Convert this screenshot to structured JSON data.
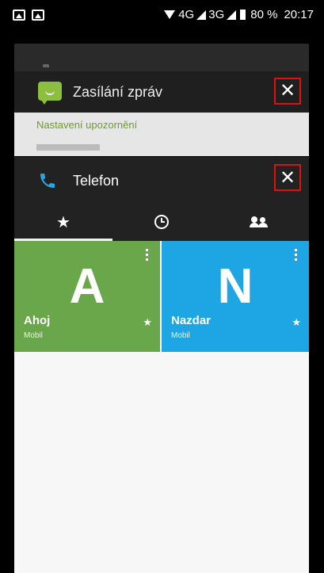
{
  "status_bar": {
    "network_4g": "4G",
    "network_3g": "3G",
    "battery": "80 %",
    "time": "20:17"
  },
  "messaging_card": {
    "title": "Zasílání zpráv",
    "close": "✕",
    "subtitle": "Nastavení upozornění",
    "icon": "message-icon",
    "accent": "#8cbf3f"
  },
  "phone_card": {
    "title": "Telefon",
    "close": "✕",
    "icon": "phone-icon",
    "accent": "#2aa5e0",
    "tabs": [
      {
        "label": "★",
        "icon": "star-icon",
        "active": true
      },
      {
        "label": "",
        "icon": "clock-icon",
        "active": false
      },
      {
        "label": "",
        "icon": "contacts-icon",
        "active": false
      }
    ],
    "contacts": [
      {
        "letter": "A",
        "name": "Ahoj",
        "type": "Mobil",
        "color": "#6aa64a",
        "favorite": "★"
      },
      {
        "letter": "N",
        "name": "Nazdar",
        "type": "Mobil",
        "color": "#1ea6e4",
        "favorite": "★"
      }
    ]
  }
}
